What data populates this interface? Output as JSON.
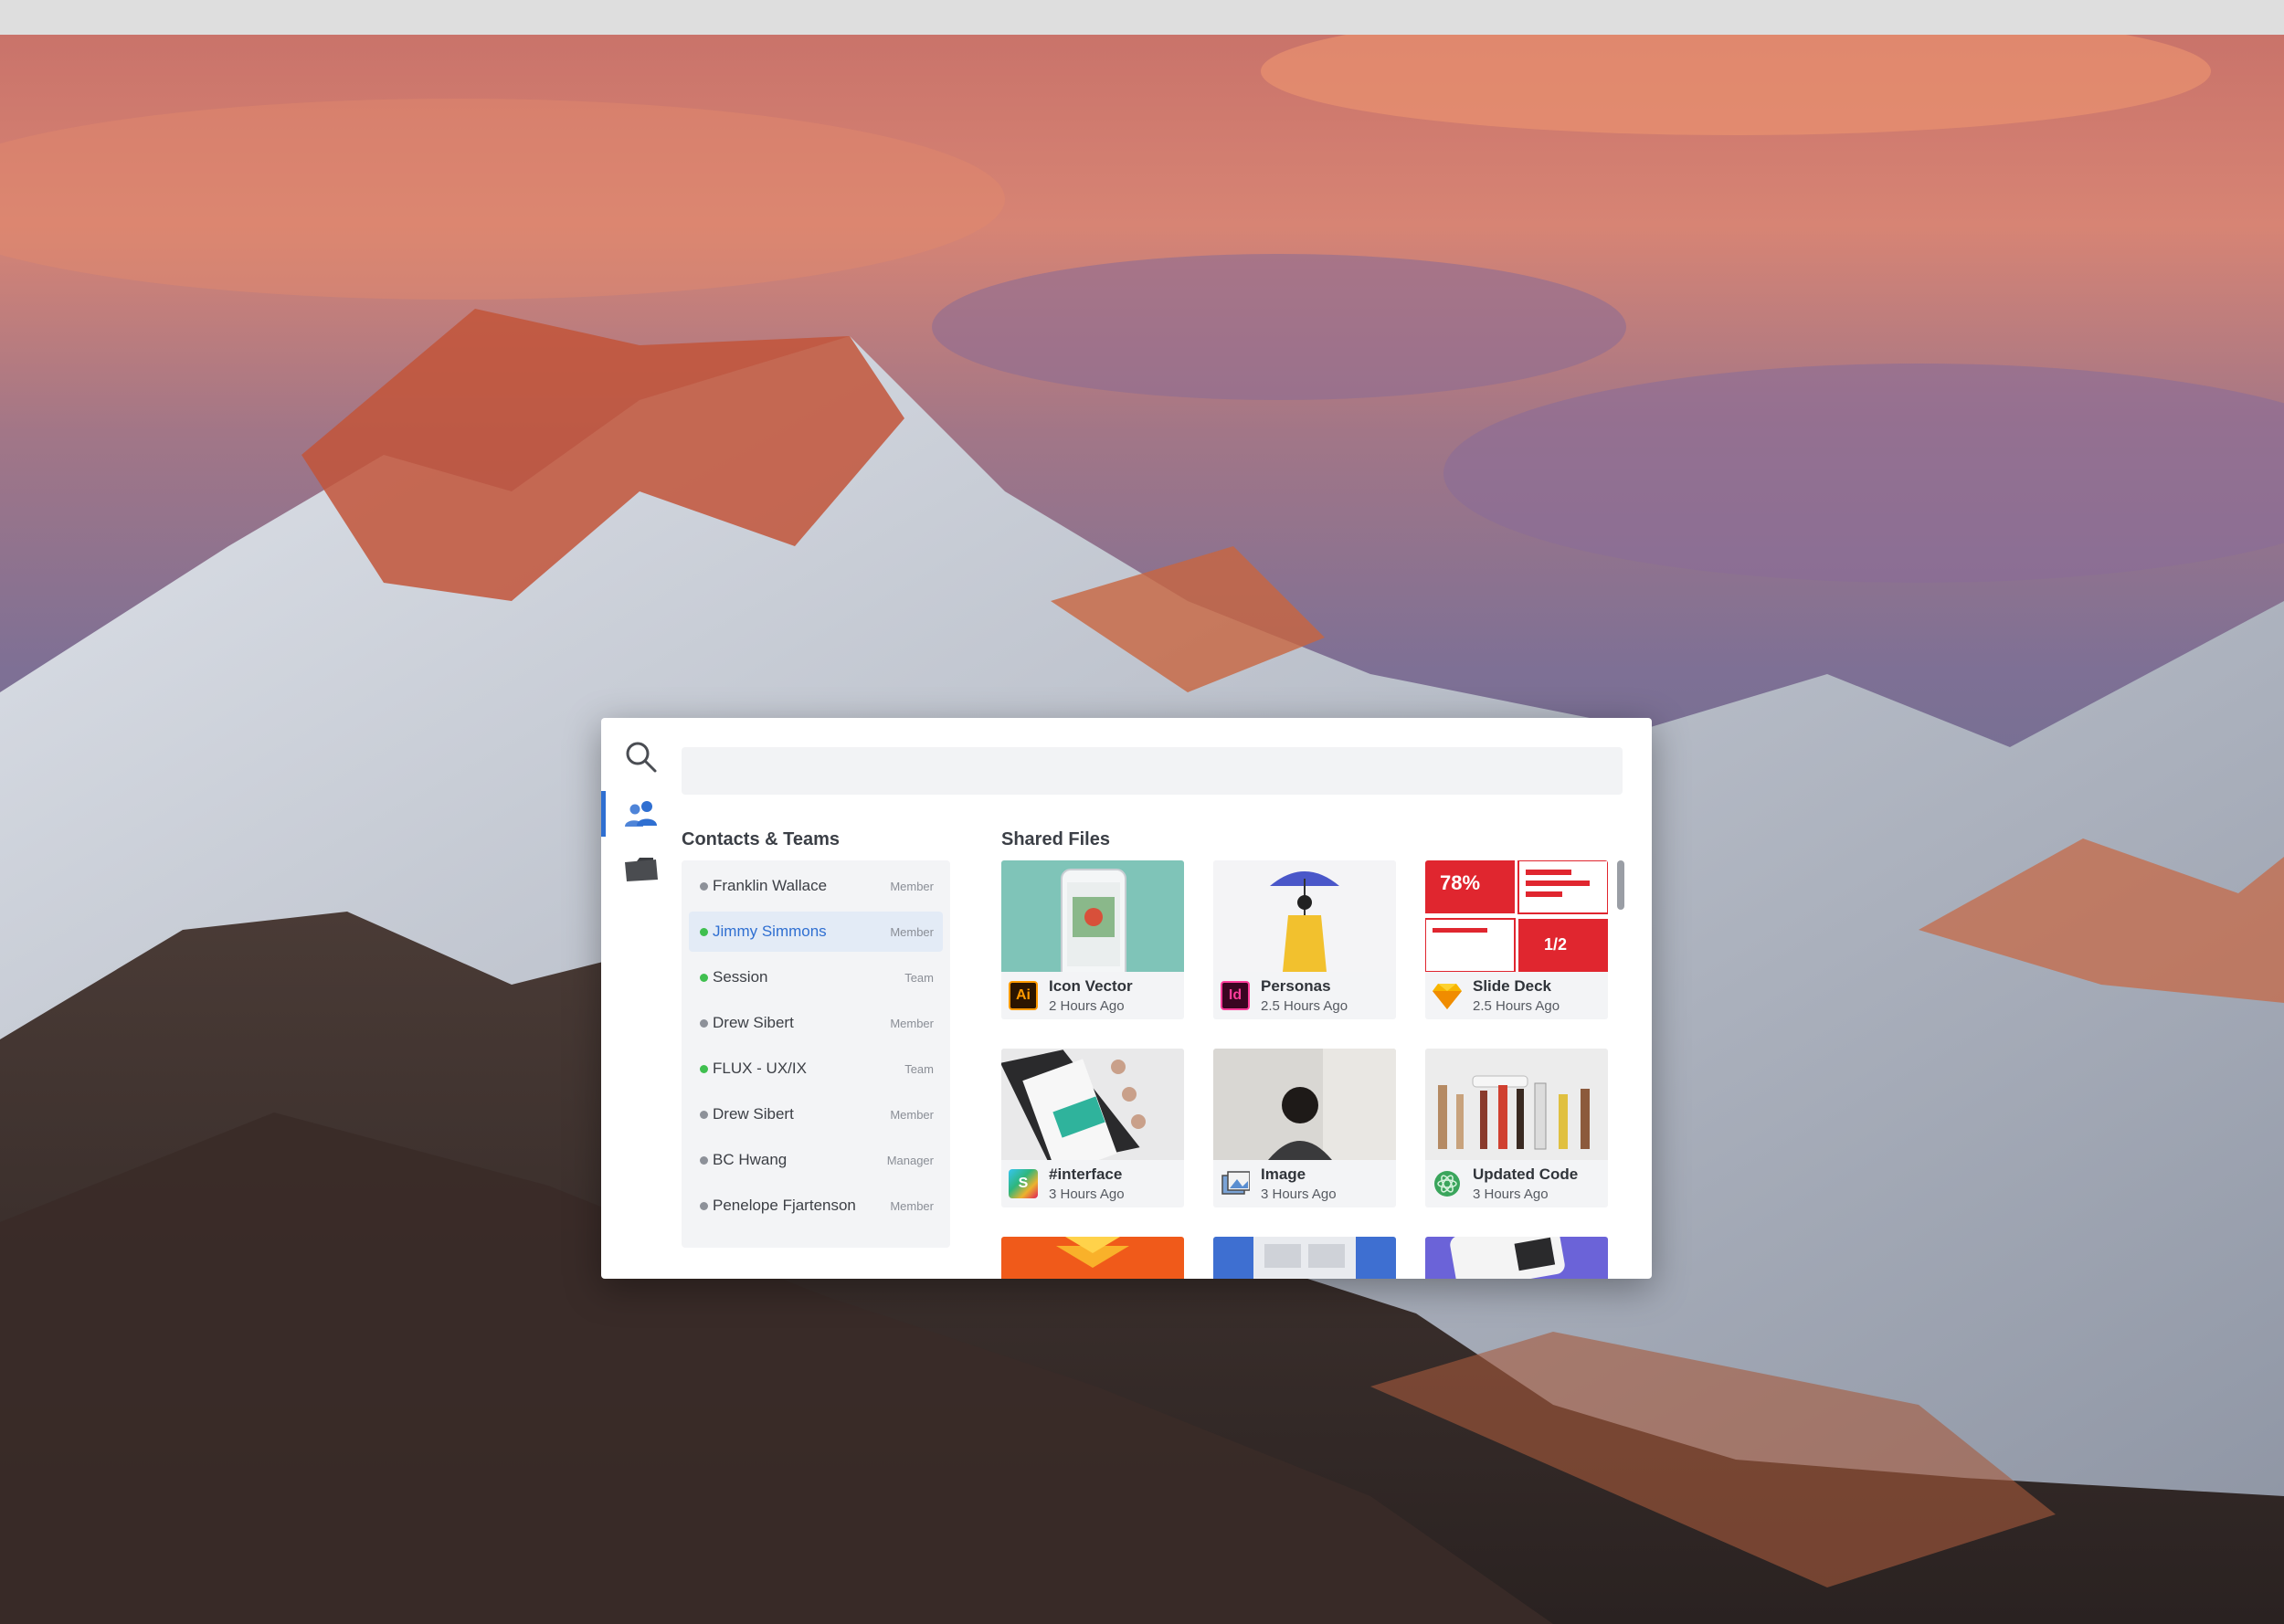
{
  "search": {
    "value": "",
    "placeholder": ""
  },
  "rail": {
    "items": [
      {
        "icon": "search-icon",
        "active": false
      },
      {
        "icon": "people-icon",
        "active": true
      },
      {
        "icon": "folder-icon",
        "active": false
      }
    ]
  },
  "contacts": {
    "title": "Contacts & Teams",
    "items": [
      {
        "name": "Franklin Wallace",
        "role": "Member",
        "status": "offline"
      },
      {
        "name": "Jimmy Simmons",
        "role": "Member",
        "status": "online",
        "selected": true
      },
      {
        "name": "Session",
        "role": "Team",
        "status": "online"
      },
      {
        "name": "Drew Sibert",
        "role": "Member",
        "status": "offline"
      },
      {
        "name": "FLUX - UX/IX",
        "role": "Team",
        "status": "online"
      },
      {
        "name": "Drew Sibert",
        "role": "Member",
        "status": "offline"
      },
      {
        "name": "BC Hwang",
        "role": "Manager",
        "status": "offline"
      },
      {
        "name": "Penelope Fjartenson",
        "role": "Member",
        "status": "offline"
      }
    ]
  },
  "files": {
    "title": "Shared Files",
    "items": [
      {
        "name": "Icon Vector",
        "time": "2 Hours Ago",
        "app_icon": "Ai"
      },
      {
        "name": "Personas",
        "time": "2.5 Hours Ago",
        "app_icon": "Id"
      },
      {
        "name": "Slide Deck",
        "time": "2.5 Hours Ago",
        "app_icon": "sketch-icon",
        "thumb_stat": "78%",
        "thumb_fraction": "1/2"
      },
      {
        "name": "#interface",
        "time": "3 Hours Ago",
        "app_icon": "S"
      },
      {
        "name": "Image",
        "time": "3 Hours Ago",
        "app_icon": "preview-icon"
      },
      {
        "name": "Updated Code",
        "time": "3 Hours Ago",
        "app_icon": "atom-icon"
      }
    ]
  },
  "colors": {
    "accent": "#2f6fd1",
    "online": "#3fbf4f",
    "offline": "#8d9199",
    "ai_bg": "#2b1500",
    "ai_fg": "#ff9a00",
    "id_bg": "#3a0521",
    "id_fg": "#ff3d9a",
    "slide_red": "#e0262f",
    "teal": "#7fc4b8"
  }
}
